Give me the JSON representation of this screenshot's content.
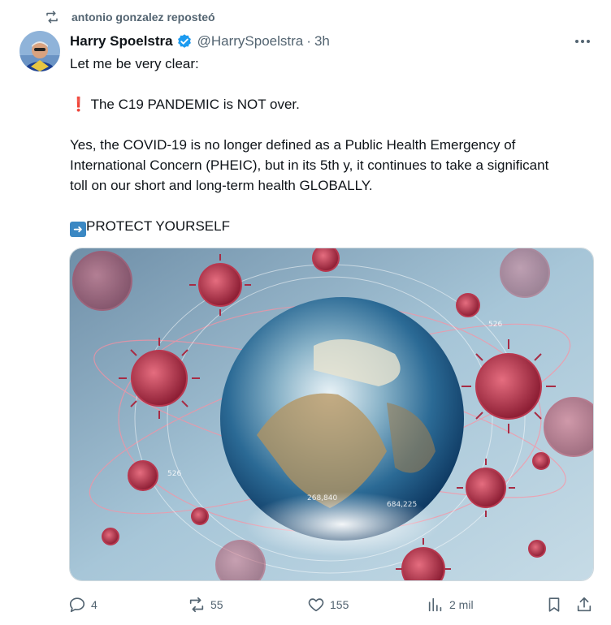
{
  "repost": {
    "text": "antonio gonzalez reposteó",
    "icon": "repost-icon"
  },
  "tweet": {
    "author_name": "Harry Spoelstra",
    "verified": true,
    "handle": "@HarrySpoelstra",
    "separator": "·",
    "time": "3h",
    "more_icon": "more-icon",
    "lines": {
      "l1": "Let me be very clear:",
      "l2_emoji": "❗",
      "l2": "The C19 PANDEMIC is NOT over.",
      "l3": "Yes, the COVID-19 is no longer defined as a Public Health Emergency of",
      "l4": "International Concern (PHEIC), but in its 5th y, it continues to take a significant",
      "l5": "toll on our short and long-term health GLOBALLY.",
      "l6_emoji": "➡️",
      "l6": "PROTECT YOURSELF"
    },
    "image_labels": {
      "a": "526",
      "b": "526",
      "c": "268,840",
      "d": "684,225"
    }
  },
  "actions": {
    "reply_count": "4",
    "repost_count": "55",
    "like_count": "155",
    "views_count": "2 mil"
  },
  "colors": {
    "muted": "#536471",
    "verified": "#1d9bf0",
    "text": "#0f1419"
  }
}
